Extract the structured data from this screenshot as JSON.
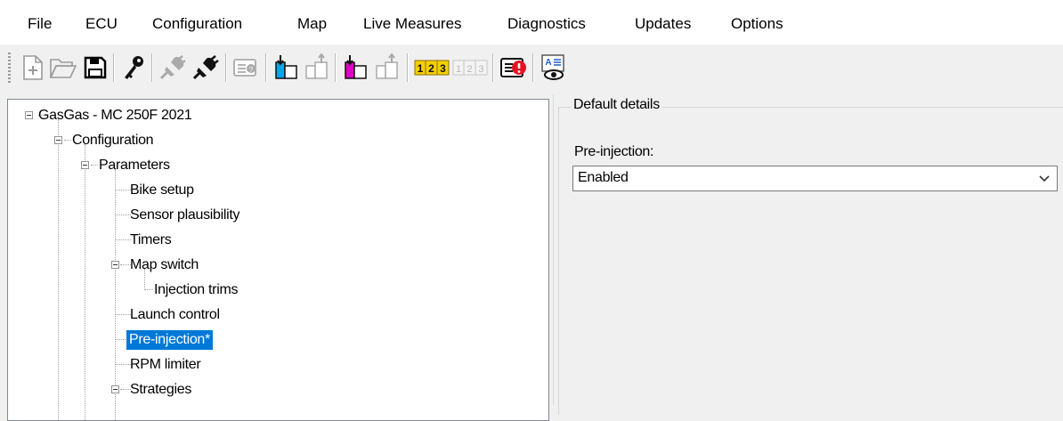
{
  "menu": [
    "File",
    "ECU",
    "Configuration",
    "Map",
    "Live Measures",
    "Diagnostics",
    "Updates",
    "Options"
  ],
  "toolbar": {
    "buttons": [
      "new-file-icon",
      "open-folder-icon",
      "save-icon",
      "key-icon",
      "disconnect-plug-icon",
      "connect-plug-icon",
      "ecu-info-icon",
      "download-cyan-icon",
      "upload-disabled-icon",
      "download-magenta-icon",
      "upload-magenta-disabled-icon",
      "map-grid-icon",
      "map-grid-disabled-icon",
      "error-codes-icon",
      "view-label-icon"
    ]
  },
  "tree": {
    "root": "GasGas - MC 250F 2021",
    "configuration": "Configuration",
    "parameters": "Parameters",
    "bike_setup": "Bike setup",
    "sensor_plausibility": "Sensor plausibility",
    "timers": "Timers",
    "map_switch": "Map switch",
    "injection_trims": "Injection trims",
    "launch_control": "Launch control",
    "pre_injection": "Pre-injection*",
    "rpm_limiter": "RPM limiter",
    "strategies": "Strategies"
  },
  "details": {
    "group_title": "Default details",
    "field_label": "Pre-injection:",
    "field_value": "Enabled"
  },
  "colors": {
    "selection": "#0078d7",
    "cyan_accent": "#00a8e8",
    "magenta_accent": "#e000c8",
    "error_red": "#e81123"
  }
}
